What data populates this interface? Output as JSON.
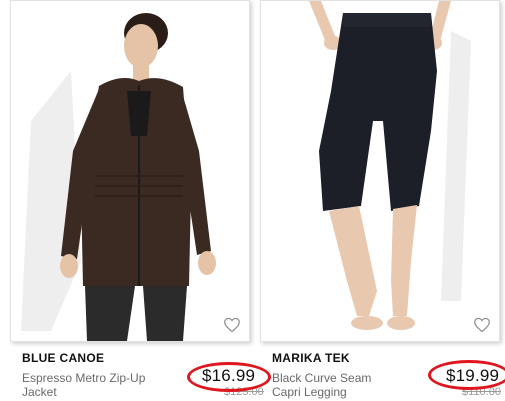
{
  "products": [
    {
      "brand": "BLUE CANOE",
      "name": "Espresso Metro Zip-Up Jacket",
      "price": "$16.99",
      "original_price": "$125.00",
      "image_subject": "woman in brown zip-up jacket",
      "favorite_icon": "heart-outline-icon",
      "colors": {
        "garment": "#3b2a22",
        "leggings": "#2b2b2b",
        "skin": "#e4c3a7"
      }
    },
    {
      "brand": "MARIKA TEK",
      "name": "Black Curve Seam Capri Legging",
      "price": "$19.99",
      "original_price": "$110.00",
      "image_subject": "black capri leggings",
      "favorite_icon": "heart-outline-icon",
      "colors": {
        "garment": "#1c1f27",
        "skin": "#e9c8b0"
      }
    }
  ],
  "highlight_color": "#e0161e"
}
